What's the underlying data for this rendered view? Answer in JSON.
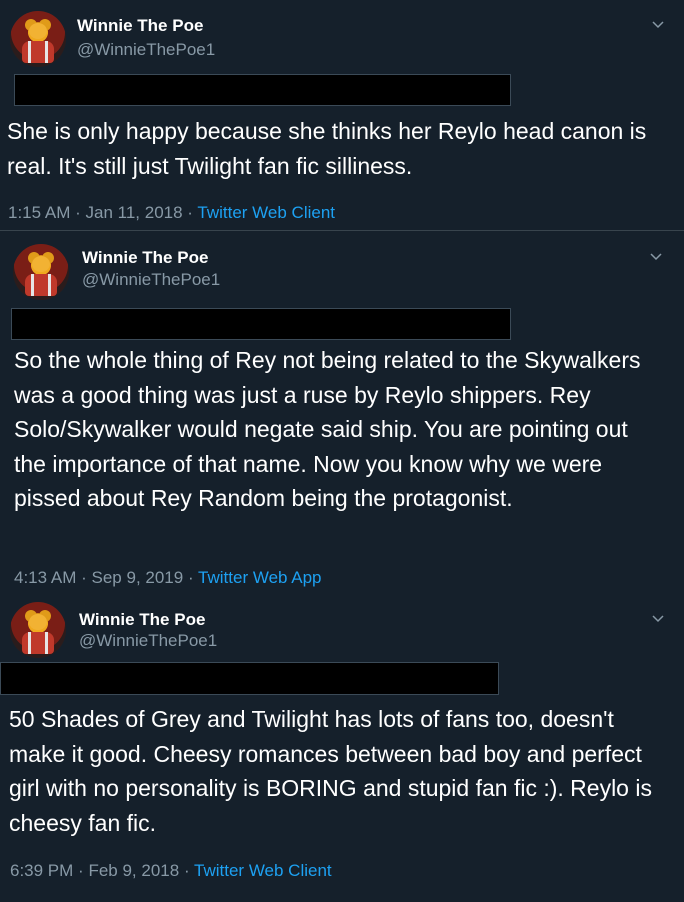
{
  "tweets": [
    {
      "author_name": "Winnie The Poe",
      "author_handle": "@WinnieThePoe1",
      "text": "She is only happy because she thinks her Reylo head canon is real.  It's still just Twilight fan fic silliness.",
      "time": "1:15 AM",
      "date": "Jan 11, 2018",
      "source": "Twitter Web Client",
      "separator": "·"
    },
    {
      "author_name": "Winnie The Poe",
      "author_handle": "@WinnieThePoe1",
      "text": "So the whole thing of Rey not being related to the Skywalkers was a good thing was just a ruse by Reylo shippers.  Rey Solo/Skywalker would negate said ship. You are pointing out the importance of that name. Now you know why we were pissed about Rey Random being the protagonist.",
      "time": "4:13 AM",
      "date": "Sep 9, 2019",
      "source": "Twitter Web App",
      "separator": "·"
    },
    {
      "author_name": "Winnie The Poe",
      "author_handle": "@WinnieThePoe1",
      "text": "50 Shades of Grey and Twilight has lots of fans too, doesn't make it good.  Cheesy romances between bad boy and perfect girl with no personality is BORING and stupid fan fic :).  Reylo is cheesy fan fic.",
      "time": "6:39 PM",
      "date": "Feb 9, 2018",
      "source": "Twitter Web Client",
      "separator": "·"
    }
  ],
  "icons": {
    "more": "chevron-down-icon",
    "avatar": "winnie-the-pooh-avatar"
  },
  "colors": {
    "background": "#15202b",
    "primary_text": "#ffffff",
    "secondary_text": "#8899a6",
    "link": "#1da1f2",
    "redaction": "#000000"
  }
}
